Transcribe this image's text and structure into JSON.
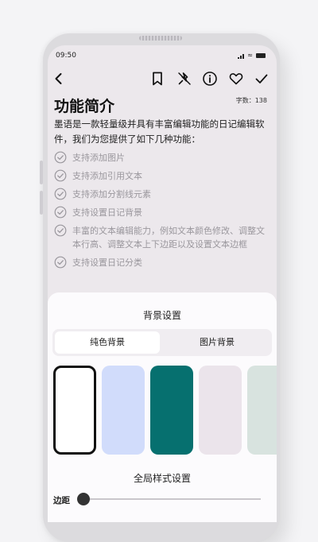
{
  "status_bar": {
    "time": "09:50"
  },
  "toolbar": {
    "back_icon": "chevron-left-icon",
    "bookmark_icon": "bookmark-icon",
    "unpin_icon": "unpin-icon",
    "info_icon": "info-icon",
    "favorite_icon": "heart-icon",
    "confirm_icon": "check-icon"
  },
  "note": {
    "title": "功能简介",
    "word_count": "字数：138",
    "intro": "墨语是一款轻量级并具有丰富编辑功能的日记编辑软件，我们为您提供了如下几种功能：",
    "features": [
      "支持添加图片",
      "支持添加引用文本",
      "支持添加分割线元素",
      "支持设置日记背景",
      "丰富的文本编辑能力，例如文本颜色修改、调整文本行高、调整文本上下边距以及设置文本边框",
      "支持设置日记分类"
    ]
  },
  "background_sheet": {
    "title": "背景设置",
    "tabs": [
      {
        "label": "纯色背景",
        "active": true
      },
      {
        "label": "图片背景",
        "active": false
      }
    ],
    "swatches": [
      {
        "color": "#ffffff",
        "selected": true
      },
      {
        "color": "#d1dcfb",
        "selected": false
      },
      {
        "color": "#06706f",
        "selected": false
      },
      {
        "color": "#ebe4eb",
        "selected": false
      },
      {
        "color": "#d8e3df",
        "selected": false
      }
    ],
    "global_title": "全局样式设置",
    "spacing_label": "边距",
    "spacing_value": 0
  },
  "colors": {
    "accent_text": "#111111",
    "muted_text": "#9a979d",
    "sheet_bg": "#fcfbfd",
    "screen_bg": "#ece8ec"
  }
}
